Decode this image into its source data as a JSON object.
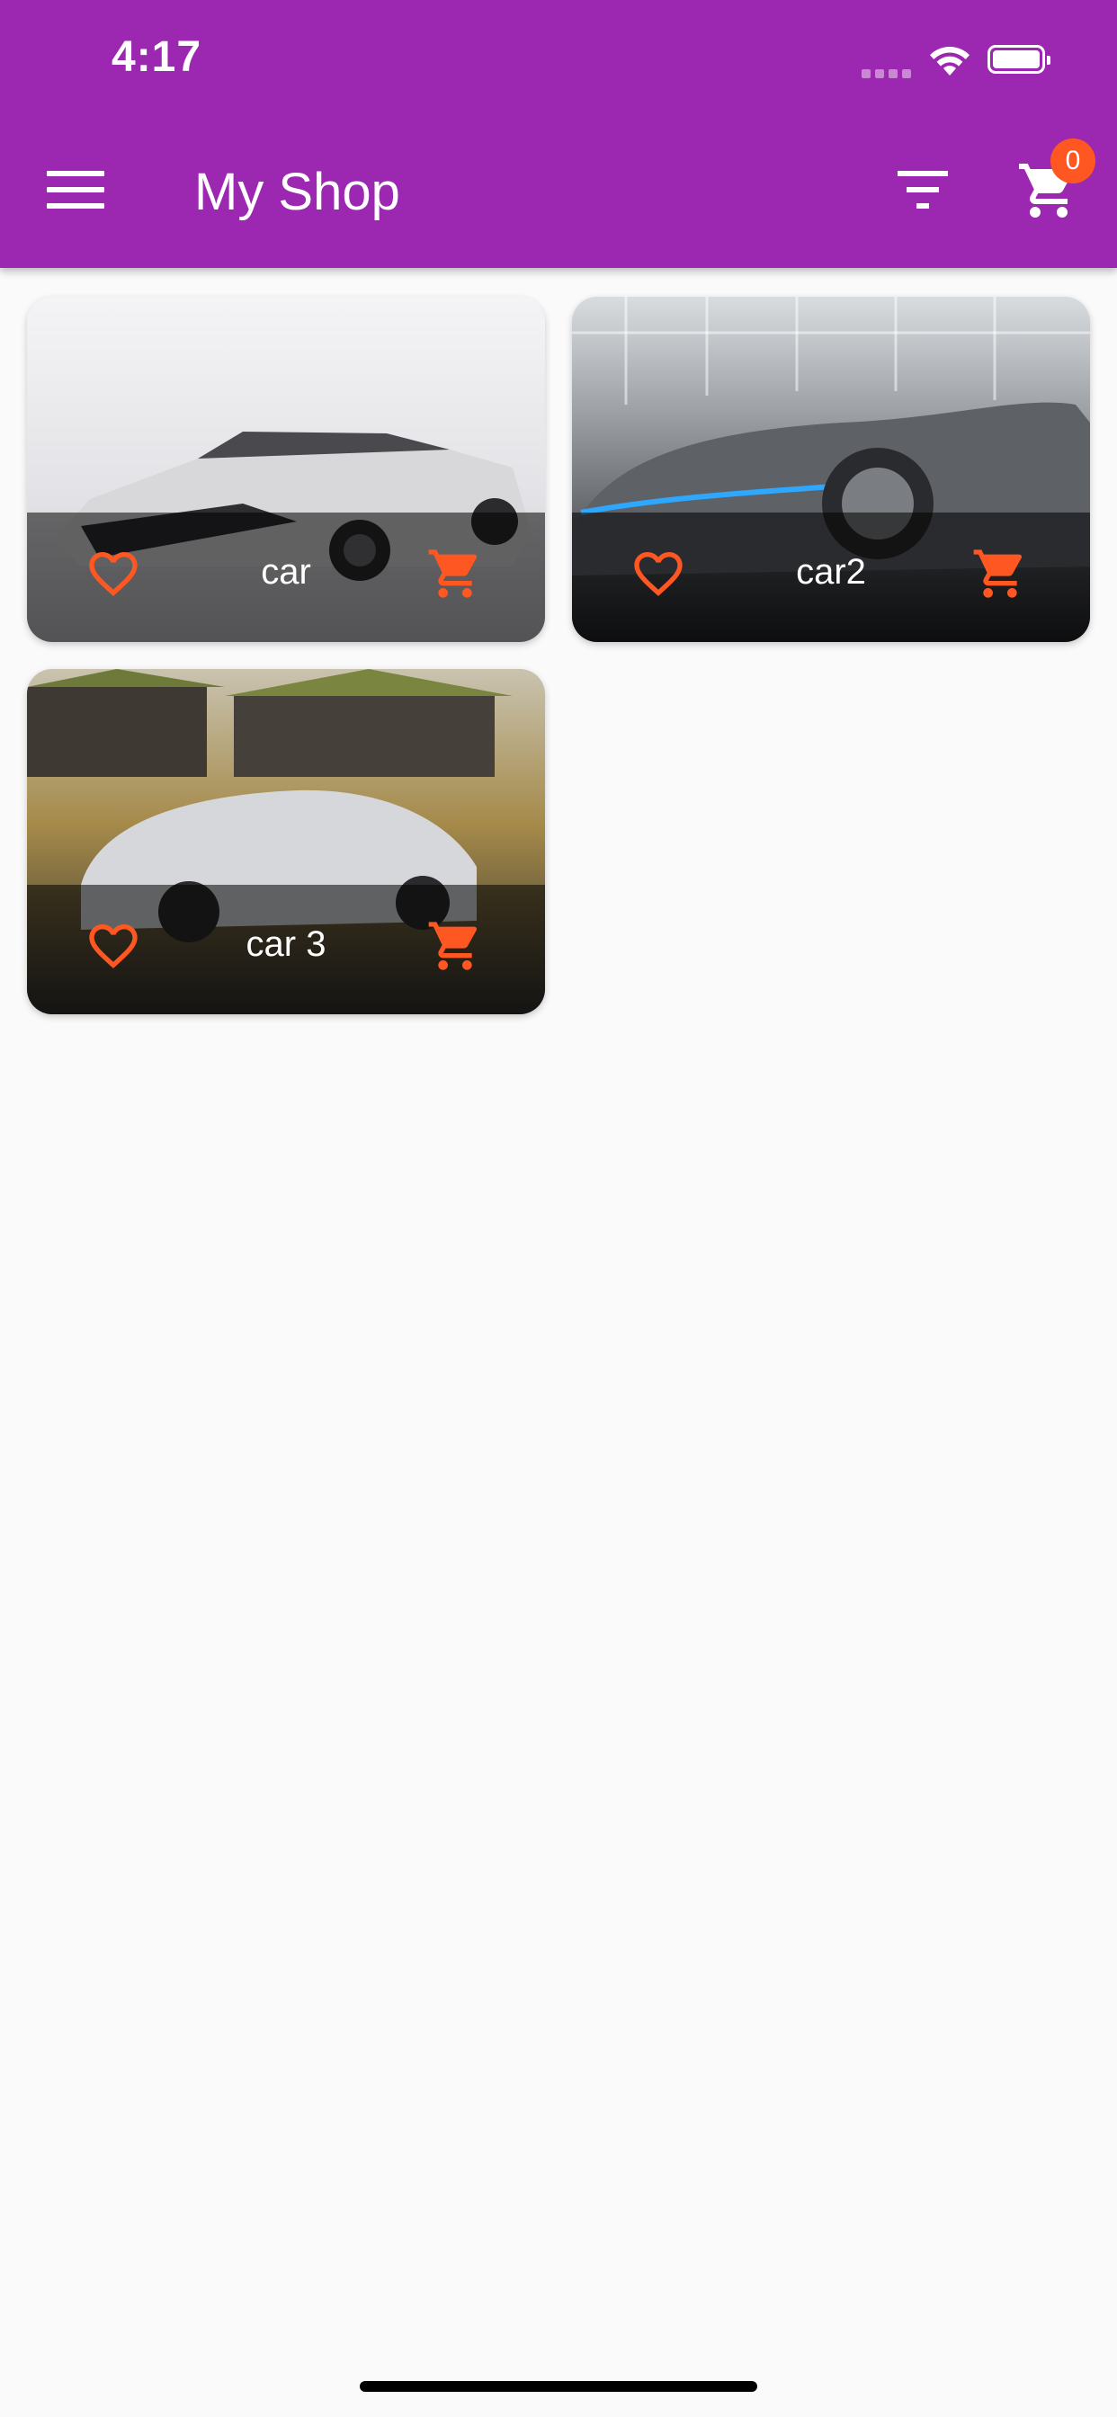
{
  "status_bar": {
    "time": "4:17"
  },
  "app_bar": {
    "title": "My Shop",
    "cart_count": "0"
  },
  "products": [
    {
      "title": "car"
    },
    {
      "title": "car2"
    },
    {
      "title": "car 3"
    }
  ],
  "colors": {
    "primary": "#9c27b0",
    "accent": "#ff5722",
    "background": "#fafafa"
  },
  "icons": [
    "menu-icon",
    "filter-icon",
    "shopping-cart-icon",
    "heart-outline-icon"
  ]
}
